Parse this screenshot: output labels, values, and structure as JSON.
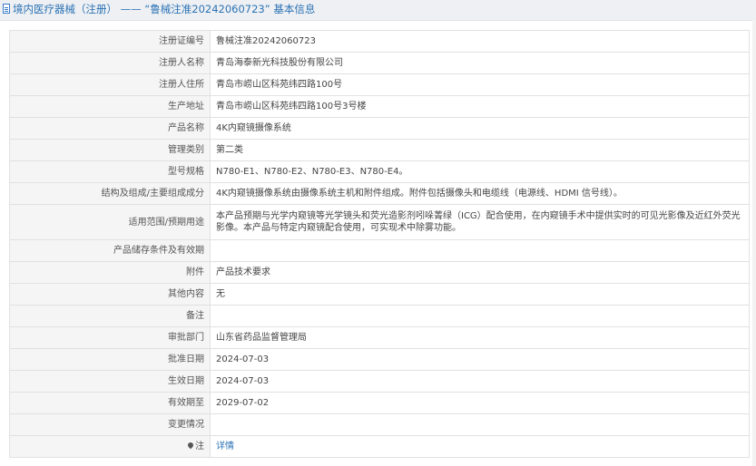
{
  "header": {
    "title": "境内医疗器械（注册） —— “鲁械注准20242060723” 基本信息"
  },
  "rows": [
    {
      "label": "注册证编号",
      "value": "鲁械注准20242060723"
    },
    {
      "label": "注册人名称",
      "value": "青岛海泰新光科技股份有限公司"
    },
    {
      "label": "注册人住所",
      "value": "青岛市崂山区科苑纬四路100号"
    },
    {
      "label": "生产地址",
      "value": "青岛市崂山区科苑纬四路100号3号楼"
    },
    {
      "label": "产品名称",
      "value": "4K内窥镜摄像系统"
    },
    {
      "label": "管理类别",
      "value": "第二类"
    },
    {
      "label": "型号规格",
      "value": "N780-E1、N780-E2、N780-E3、N780-E4。"
    },
    {
      "label": "结构及组成/主要组成成分",
      "value": "4K内窥镜摄像系统由摄像系统主机和附件组成。附件包括摄像头和电缆线（电源线、HDMI 信号线）。"
    },
    {
      "label": "适用范围/预期用途",
      "value": "本产品预期与光学内窥镜等光学镜头和荧光造影剂吲哚菁绿（ICG）配合使用，在内窥镜手术中提供实时的可见光影像及近红外荧光影像。本产品与特定内窥镜配合使用，可实现术中除雾功能。"
    },
    {
      "label": "产品储存条件及有效期",
      "value": ""
    },
    {
      "label": "附件",
      "value": "产品技术要求"
    },
    {
      "label": "其他内容",
      "value": "无"
    },
    {
      "label": "备注",
      "value": ""
    },
    {
      "label": "审批部门",
      "value": "山东省药品监督管理局"
    },
    {
      "label": "批准日期",
      "value": "2024-07-03"
    },
    {
      "label": "生效日期",
      "value": "2024-07-03"
    },
    {
      "label": "有效期至",
      "value": "2029-07-02"
    },
    {
      "label": "变更情况",
      "value": ""
    },
    {
      "label": "注",
      "value": "详情",
      "label_icon": "pin-icon"
    }
  ],
  "colors": {
    "header_bg": "#eef0f3",
    "link": "#2b72b5",
    "label_bg": "#f5f5f5",
    "border": "#e1e1e1"
  }
}
